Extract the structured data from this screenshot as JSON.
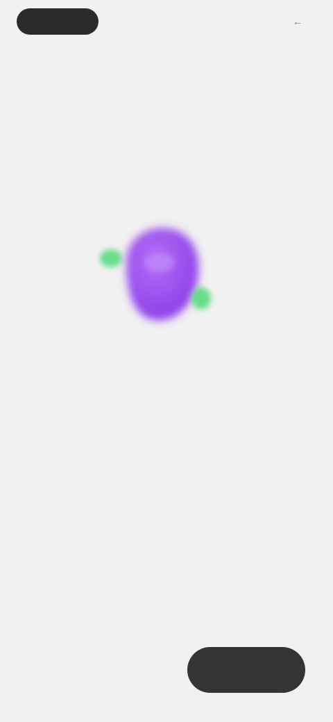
{
  "status": {
    "label": ""
  },
  "top_action": {
    "label": "",
    "icon": "arrow-icon"
  },
  "header": {
    "sub_label": "",
    "sub_label_2": ""
  },
  "illustration": {
    "accent_purple": "#9a49f0",
    "accent_green": "#4fdc77",
    "icon": "orbit-planet-icon"
  },
  "main": {
    "title": "",
    "body": ""
  },
  "footer": {
    "secondary_label": "",
    "primary_label": ""
  }
}
